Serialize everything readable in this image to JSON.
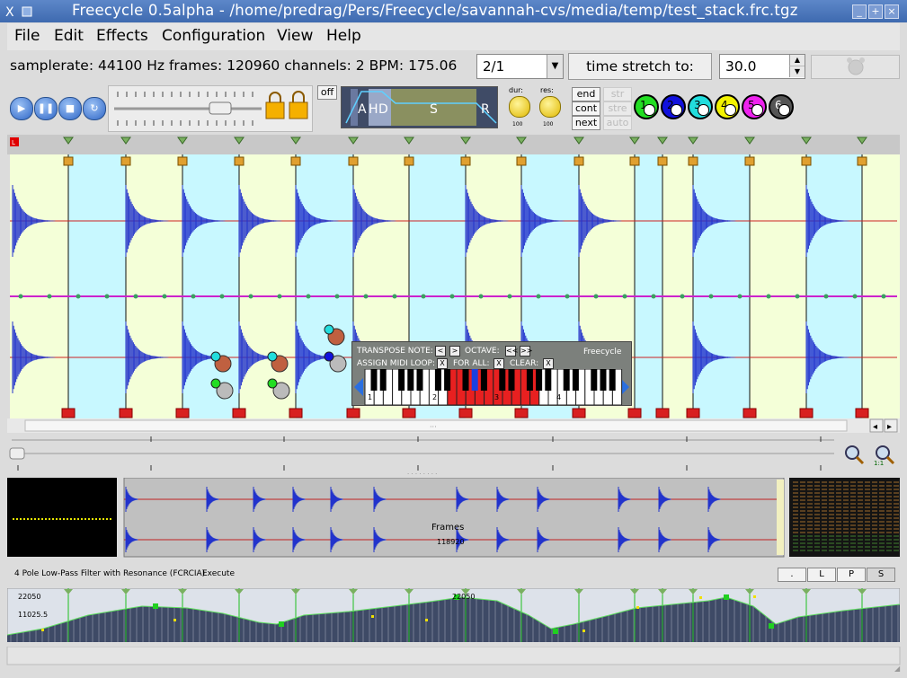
{
  "window": {
    "title": "Freecycle 0.5alpha - /home/predrag/Pers/Freecycle/savannah-cvs/media/temp/test_stack.frc.tgz",
    "app_icon": "x-icon",
    "buttons": [
      "_",
      "+",
      "×"
    ]
  },
  "menu": [
    "File",
    "Edit",
    "Effects",
    "Configuration",
    "View",
    "Help"
  ],
  "info": {
    "text": "samplerate: 44100 Hz frames: 120960 channels: 2 BPM: 175.06",
    "ratio_value": "2/1",
    "stretch_label": "time stretch to:",
    "stretch_value": "30.0"
  },
  "toolbar": {
    "transport_icons": [
      "play-icon",
      "pause-icon",
      "stop-icon",
      "loop-icon"
    ],
    "off_label": "off",
    "envelope_labels": [
      "A",
      "H",
      "D",
      "S",
      "R"
    ],
    "dur_label": "dur:",
    "res_label": "res:",
    "knob_value_a": "100",
    "knob_value_b": "100",
    "buttons": [
      "end",
      "cont",
      "next"
    ],
    "disabled_buttons": [
      "str",
      "stre",
      "auto"
    ],
    "channels": [
      {
        "label": "1",
        "color": "#22dd22"
      },
      {
        "label": "2",
        "color": "#1111dd"
      },
      {
        "label": "3",
        "color": "#22dddd"
      },
      {
        "label": "4",
        "color": "#f2f200"
      },
      {
        "label": "5",
        "color": "#ee22ee"
      },
      {
        "label": "6",
        "color": "#555555"
      }
    ]
  },
  "main": {
    "segment_colors": [
      "#f4ffd8",
      "#c8f8ff"
    ],
    "marker_label": "L",
    "wave_color": "#2233cc",
    "baseline_color": "#cc2222",
    "center_color": "#cc22cc"
  },
  "popup": {
    "transpose_label": "TRANSPOSE NOTE:",
    "octave_label": "OCTAVE:",
    "brand": "Freecycle",
    "assign_label": "ASSIGN MIDI LOOP:",
    "for_all_label": "FOR ALL:",
    "clear_label": "CLEAR:",
    "x_label": "X",
    "lt": "<",
    "gt": ">",
    "dlt": "<<",
    "dgt": ">>",
    "octaves": [
      "1",
      "2",
      "3",
      "4"
    ]
  },
  "overview": {
    "frames_label": "Frames",
    "frames_value": "118920"
  },
  "filter": {
    "name": "4 Pole Low-Pass Filter with Resonance (FCRCIA)",
    "execute_label": "Execute",
    "buttons": [
      ".",
      "L",
      "P",
      "S"
    ]
  },
  "envelope": {
    "top_label": "22050",
    "mid_label": "11025.5",
    "peak_label": "22050"
  }
}
